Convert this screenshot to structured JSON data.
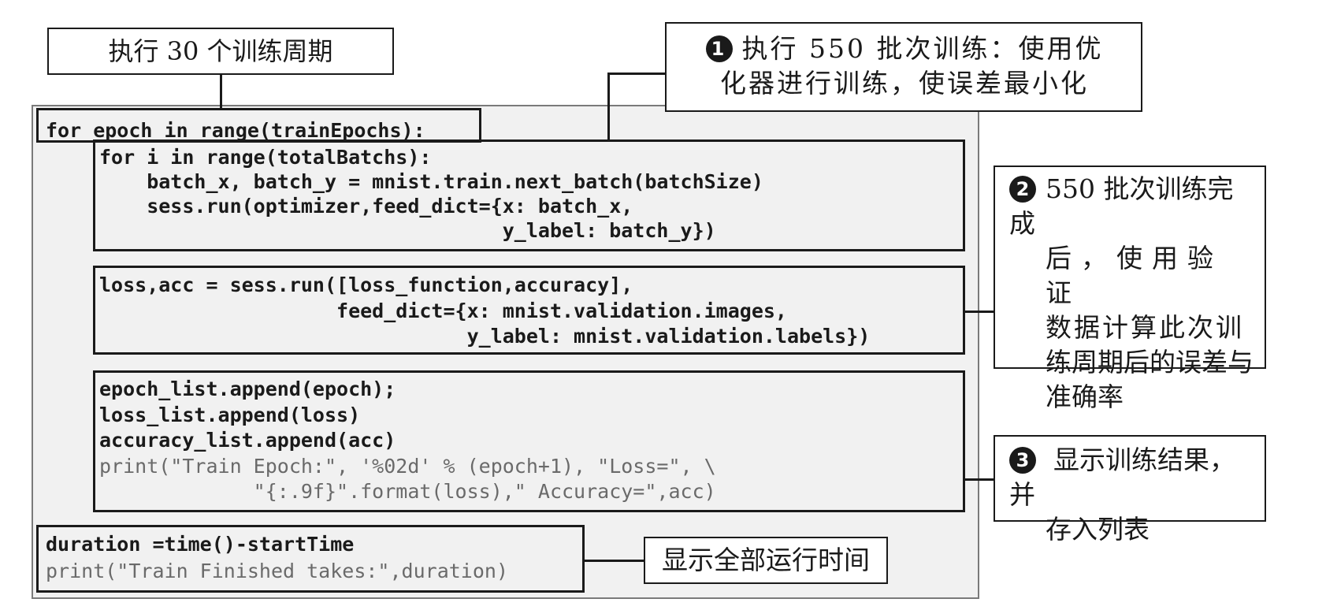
{
  "callouts": {
    "epochs": "执行 30 个训练周期",
    "step1": {
      "badge": "1",
      "line1": "执行 550 批次训练：使用优",
      "line2": "化器进行训练，使误差最小化"
    },
    "step2": {
      "badge": "2",
      "line1": "550 批次训练完成",
      "line2": "后，使用验证",
      "line3": "数据计算此次训",
      "line4": "练周期后的误差与",
      "line5": "准确率"
    },
    "step3": {
      "badge": "3",
      "line1": "显示训练结果，并",
      "line2": "存入列表"
    },
    "duration": "显示全部运行时间"
  },
  "code": {
    "outer_loop": "for epoch in range(trainEpochs):",
    "batch_loop": [
      "for i in range(totalBatchs):",
      "    batch_x, batch_y = mnist.train.next_batch(batchSize)",
      "    sess.run(optimizer,feed_dict={x: batch_x,",
      "                                  y_label: batch_y})"
    ],
    "validation": [
      "loss,acc = sess.run([loss_function,accuracy],",
      "                    feed_dict={x: mnist.validation.images,",
      "                               y_label: mnist.validation.labels})"
    ],
    "record": [
      "epoch_list.append(epoch);",
      "loss_list.append(loss)",
      "accuracy_list.append(acc)",
      "print(\"Train Epoch:\", '%02d' % (epoch+1), \"Loss=\", \\",
      "             \"{:.9f}\".format(loss),\" Accuracy=\",acc)"
    ],
    "duration": [
      "duration =time()-startTime",
      "print(\"Train Finished takes:\",duration)"
    ]
  }
}
